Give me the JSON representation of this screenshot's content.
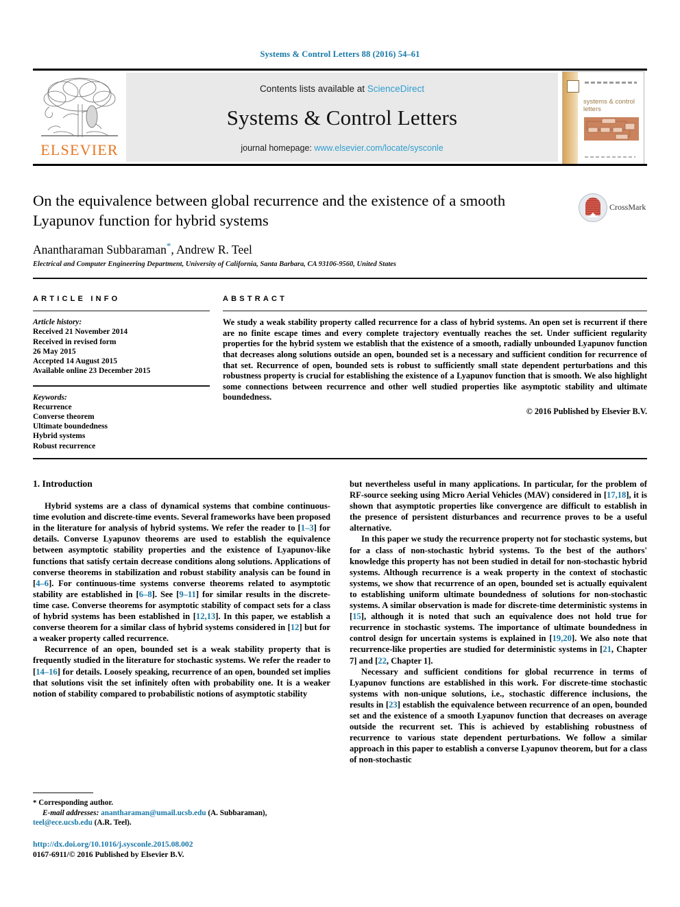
{
  "running_head": "Systems & Control Letters 88 (2016) 54–61",
  "masthead": {
    "contents_prefix": "Contents lists available at ",
    "sciencedirect": "ScienceDirect",
    "journal_title": "Systems & Control Letters",
    "homepage_prefix": "journal homepage: ",
    "homepage_url": "www.elsevier.com/locate/sysconle",
    "publisher": "ELSEVIER",
    "cover_title": "systems & control letters",
    "accent_orange": "#e87722",
    "accent_blue": "#2f9fd0"
  },
  "article": {
    "title": "On the equivalence between global recurrence and the existence of a smooth Lyapunov function for hybrid systems",
    "authors_part1": "Anantharaman Subbaraman",
    "authors_star": "*",
    "authors_part2": ", Andrew R. Teel",
    "affiliation": "Electrical and Computer Engineering Department, University of California, Santa Barbara, CA 93106-9560, United States",
    "crossmark_label": "CrossMark"
  },
  "info": {
    "heading": "ARTICLE INFO",
    "history_label": "Article history:",
    "history": [
      "Received 21 November 2014",
      "Received in revised form",
      "26 May 2015",
      "Accepted 14 August 2015",
      "Available online 23 December 2015"
    ],
    "keywords_label": "Keywords:",
    "keywords": [
      "Recurrence",
      "Converse theorem",
      "Ultimate boundedness",
      "Hybrid systems",
      "Robust recurrence"
    ]
  },
  "abstract": {
    "heading": "ABSTRACT",
    "text": "We study a weak stability property called recurrence for a class of hybrid systems. An open set is recurrent if there are no finite escape times and every complete trajectory eventually reaches the set. Under sufficient regularity properties for the hybrid system we establish that the existence of a smooth, radially unbounded Lyapunov function that decreases along solutions outside an open, bounded set is a necessary and sufficient condition for recurrence of that set. Recurrence of open, bounded sets is robust to sufficiently small state dependent perturbations and this robustness property is crucial for establishing the existence of a Lyapunov function that is smooth. We also highlight some connections between recurrence and other well studied properties like asymptotic stability and ultimate boundedness.",
    "copyright": "© 2016 Published by Elsevier B.V."
  },
  "body": {
    "section_heading": "1. Introduction",
    "left_p1_a": "Hybrid systems are a class of dynamical systems that combine continuous-time evolution and discrete-time events. Several frameworks have been proposed in the literature for analysis of hybrid systems. We refer the reader to [",
    "left_p1_ref1": "1–3",
    "left_p1_b": "] for details. Converse Lyapunov theorems are used to establish the equivalence between asymptotic stability properties and the existence of Lyapunov-like functions that satisfy certain decrease conditions along solutions. Applications of converse theorems in stabilization and robust stability analysis can be found in [",
    "left_p1_ref2": "4–6",
    "left_p1_c": "]. For continuous-time systems converse theorems related to asymptotic stability are established in [",
    "left_p1_ref3": "6–8",
    "left_p1_d": "]. See [",
    "left_p1_ref4": "9–11",
    "left_p1_e": "] for similar results in the discrete-time case. Converse theorems for asymptotic stability of compact sets for a class of hybrid systems has been established in [",
    "left_p1_ref5": "12,13",
    "left_p1_f": "]. In this paper, we establish a converse theorem for a similar class of hybrid systems considered in [",
    "left_p1_ref6": "12",
    "left_p1_g": "] but for a weaker property called recurrence.",
    "left_p2_a": "Recurrence of an open, bounded set is a weak stability property that is frequently studied in the literature for stochastic systems. We refer the reader to [",
    "left_p2_ref1": "14–16",
    "left_p2_b": "] for details. Loosely speaking, recurrence of an open, bounded set implies that solutions visit the set infinitely often with probability one. It is a weaker notion of stability compared to probabilistic notions of asymptotic stability",
    "right_p1_a": "but nevertheless useful in many applications. In particular, for the problem of RF-source seeking using Micro Aerial Vehicles (MAV) considered in [",
    "right_p1_ref1": "17,18",
    "right_p1_b": "], it is shown that asymptotic properties like convergence are difficult to establish in the presence of persistent disturbances and recurrence proves to be a useful alternative.",
    "right_p2_a": "In this paper we study the recurrence property not for stochastic systems, but for a class of non-stochastic hybrid systems. To the best of the authors' knowledge this property has not been studied in detail for non-stochastic hybrid systems. Although recurrence is a weak property in the context of stochastic systems, we show that recurrence of an open, bounded set is actually equivalent to establishing uniform ultimate boundedness of solutions for non-stochastic systems. A similar observation is made for discrete-time deterministic systems in [",
    "right_p2_ref1": "15",
    "right_p2_b": "], although it is noted that such an equivalence does not hold true for recurrence in stochastic systems. The importance of ultimate boundedness in control design for uncertain systems is explained in [",
    "right_p2_ref2": "19,20",
    "right_p2_c": "]. We also note that recurrence-like properties are studied for deterministic systems in [",
    "right_p2_ref3": "21",
    "right_p2_d": ", Chapter 7] and [",
    "right_p2_ref4": "22",
    "right_p2_e": ", Chapter 1].",
    "right_p3_a": "Necessary and sufficient conditions for global recurrence in terms of Lyapunov functions are established in this work. For discrete-time stochastic systems with non-unique solutions, i.e., stochastic difference inclusions, the results in [",
    "right_p3_ref1": "23",
    "right_p3_b": "] establish the equivalence between recurrence of an open, bounded set and the existence of a smooth Lyapunov function that decreases on average outside the recurrent set. This is achieved by establishing robustness of recurrence to various state dependent perturbations. We follow a similar approach in this paper to establish a converse Lyapunov theorem, but for a class of non-stochastic"
  },
  "footnote": {
    "star": "*",
    "corresponding": "Corresponding author.",
    "email_label": "E-mail addresses:",
    "email1": "anantharaman@umail.ucsb.edu",
    "email1_owner": " (A. Subbaraman),",
    "email2": "teel@ece.ucsb.edu",
    "email2_owner": " (A.R. Teel).",
    "doi": "http://dx.doi.org/10.1016/j.sysconle.2015.08.002",
    "issn_line": "0167-6911/© 2016 Published by Elsevier B.V."
  }
}
